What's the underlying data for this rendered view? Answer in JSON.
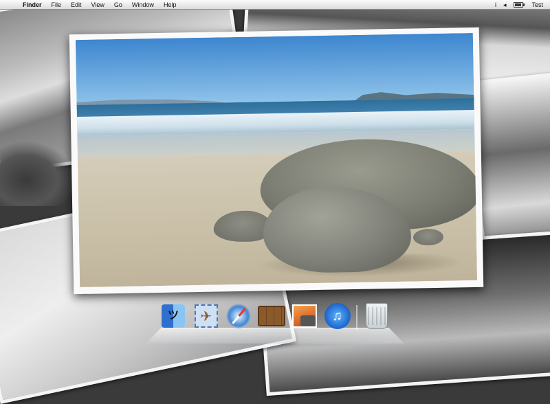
{
  "menubar": {
    "app_menu": "Finder",
    "menus": [
      "File",
      "Edit",
      "View",
      "Go",
      "Window",
      "Help"
    ],
    "status": {
      "info_icon": "i",
      "volume_icon": "◂",
      "user": "Test"
    }
  },
  "desktop": {
    "main_photo": "beach-photo-color",
    "background": "grayscale-photo-collage"
  },
  "dock": {
    "items": [
      {
        "name": "Finder",
        "icon": "finder-icon"
      },
      {
        "name": "Mail",
        "icon": "mail-icon"
      },
      {
        "name": "Safari",
        "icon": "safari-icon"
      },
      {
        "name": "Dashboard",
        "icon": "dashboard-icon"
      },
      {
        "name": "iPhoto",
        "icon": "iphoto-icon"
      },
      {
        "name": "iTunes",
        "icon": "itunes-icon"
      },
      {
        "name": "Trash",
        "icon": "trash-icon"
      }
    ]
  },
  "colors": {
    "menubar_bg": "#e8e8e8",
    "photo_border": "#fafafa"
  }
}
